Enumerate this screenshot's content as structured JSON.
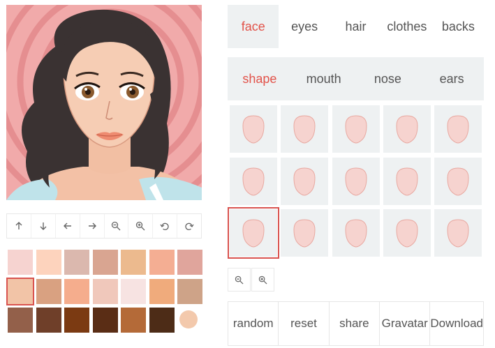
{
  "main_tabs": [
    {
      "label": "face",
      "active": true
    },
    {
      "label": "eyes",
      "active": false
    },
    {
      "label": "hair",
      "active": false
    },
    {
      "label": "clothes",
      "active": false
    },
    {
      "label": "backs",
      "active": false
    }
  ],
  "sub_tabs": [
    {
      "label": "shape",
      "active": true
    },
    {
      "label": "mouth",
      "active": false
    },
    {
      "label": "nose",
      "active": false
    },
    {
      "label": "ears",
      "active": false
    }
  ],
  "tools": [
    {
      "name": "move-up",
      "icon": "arrow-up-icon"
    },
    {
      "name": "move-down",
      "icon": "arrow-down-icon"
    },
    {
      "name": "move-left",
      "icon": "arrow-left-icon"
    },
    {
      "name": "move-right",
      "icon": "arrow-right-icon"
    },
    {
      "name": "zoom-out",
      "icon": "zoom-out-icon"
    },
    {
      "name": "zoom-in",
      "icon": "zoom-in-icon"
    },
    {
      "name": "undo",
      "icon": "undo-icon"
    },
    {
      "name": "redo",
      "icon": "redo-icon"
    }
  ],
  "skin_colors": [
    "#f6d3d0",
    "#fdd3bd",
    "#dbb8ae",
    "#d9a591",
    "#ecba8e",
    "#f4ae93",
    "#e0a59c",
    "#f2c4a7",
    "#d9a181",
    "#f5ad8d",
    "#f0c8bb",
    "#f7e3e2",
    "#f0ab7c",
    "#cea388",
    "#93604a",
    "#6f3f29",
    "#7b3a12",
    "#5a2d15",
    "#b46a38",
    "#4d2c17",
    "#f3c9ac"
  ],
  "selected_skin_index": 7,
  "face_shape_count": 15,
  "selected_shape_index": 10,
  "shape_fill": "#f6d3cf",
  "shape_stroke": "#e8a8a0",
  "zoom_buttons": [
    {
      "name": "zoom-out",
      "icon": "zoom-out-icon"
    },
    {
      "name": "zoom-in",
      "icon": "zoom-in-icon"
    }
  ],
  "actions": [
    {
      "label": "random"
    },
    {
      "label": "reset"
    },
    {
      "label": "share"
    },
    {
      "label": "Gravatar"
    },
    {
      "label": "Download"
    }
  ],
  "colors": {
    "accent": "#e2534a",
    "selection": "#d9534f",
    "panel": "#eef1f2",
    "text": "#555555",
    "avatar_bg": "#f1aaaa"
  }
}
